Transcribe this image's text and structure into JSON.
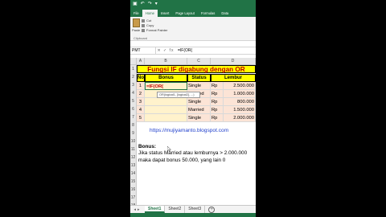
{
  "quick_access": {
    "save_icon": "save-icon",
    "undo_icon": "undo-icon",
    "redo_icon": "redo-icon"
  },
  "tabs": [
    "File",
    "Home",
    "Insert",
    "Page Layout",
    "Formulas",
    "Data"
  ],
  "ribbon": {
    "paste": "Paste",
    "cut": "Cut",
    "copy": "Copy",
    "format_painter": "Format Painter",
    "clipboard": "Clipboard"
  },
  "formula_bar": {
    "namebox": "PMT",
    "icons": "✕ ✓ fx",
    "value": "=IF(OR("
  },
  "columns": [
    "A",
    "B",
    "C",
    "D"
  ],
  "rows": [
    "1",
    "2",
    "3",
    "4",
    "5",
    "6",
    "7",
    "8",
    "9",
    "10",
    "11",
    "12",
    "13",
    "14",
    "15",
    "16",
    "17",
    "18"
  ],
  "sheet_title": "Fungsi IF digabung dengan OR",
  "table": {
    "headers": [
      "No",
      "Bonus",
      "Status",
      "Lembur"
    ],
    "rows": [
      {
        "no": "1",
        "bonus": "=IF(OR(",
        "status": "Single",
        "rp": "Rp",
        "lembur": "2.500.000"
      },
      {
        "no": "2",
        "bonus": "",
        "status": "Married",
        "rp": "Rp",
        "lembur": "1.000.000"
      },
      {
        "no": "3",
        "bonus": "",
        "status": "Single",
        "rp": "Rp",
        "lembur": "800.000"
      },
      {
        "no": "4",
        "bonus": "",
        "status": "Married",
        "rp": "Rp",
        "lembur": "1.500.000"
      },
      {
        "no": "5",
        "bonus": "",
        "status": "Single",
        "rp": "Rp",
        "lembur": "2.000.000"
      }
    ]
  },
  "tooltip": "OR(logical1, [logical2], ...)",
  "link": "https://mujiyamanto.blogspot.com",
  "bonus": {
    "title": "Bonus:",
    "line1": "Jika status Married atau lemburnya > 2.000.000",
    "line2": "maka dapat bonus 50.000, yang lain 0"
  },
  "sheets": [
    "Sheet1",
    "Sheet2",
    "Sheet3"
  ],
  "colors": {
    "excel_green": "#217346",
    "title_red": "#c00000",
    "header_yellow": "#ffff00"
  }
}
